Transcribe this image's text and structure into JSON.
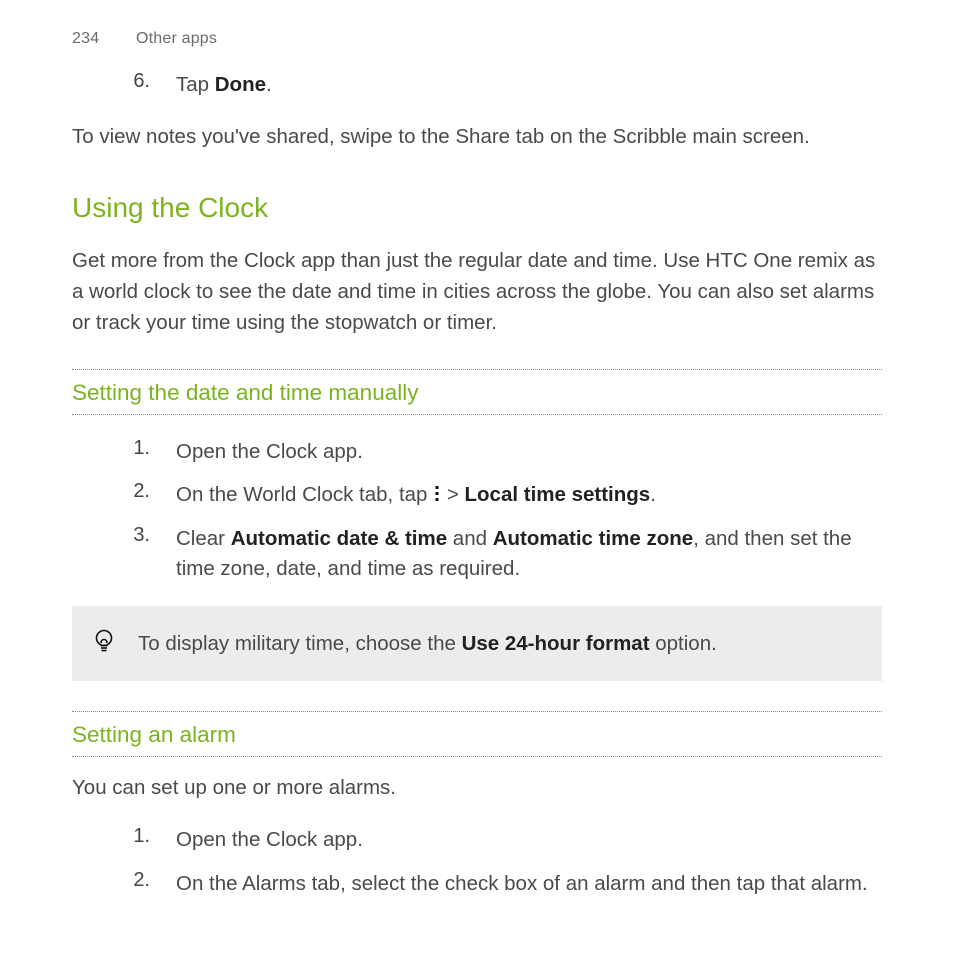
{
  "header": {
    "page_number": "234",
    "section": "Other apps"
  },
  "top_step": {
    "num": "6.",
    "prefix": "Tap ",
    "bold": "Done",
    "suffix": "."
  },
  "top_para": "To view notes you've shared, swipe to the Share tab on the Scribble main screen.",
  "section_heading": "Using the Clock",
  "section_intro": "Get more from the Clock app than just the regular date and time. Use HTC One remix as a world clock to see the date and time in cities across the globe. You can also set alarms or track your time using the stopwatch or timer.",
  "sub1": {
    "title": "Setting the date and time manually",
    "steps": {
      "s1": {
        "num": "1.",
        "text": "Open the Clock app."
      },
      "s2": {
        "num": "2.",
        "pre": "On the World Clock tab, tap ",
        "mid": " > ",
        "bold": "Local time settings",
        "post": "."
      },
      "s3": {
        "num": "3.",
        "pre": "Clear ",
        "b1": "Automatic date & time",
        "mid": " and ",
        "b2": "Automatic time zone",
        "post": ", and then set the time zone, date, and time as required."
      }
    },
    "tip": {
      "pre": "To display military time, choose the ",
      "bold": "Use 24-hour format",
      "post": " option."
    }
  },
  "sub2": {
    "title": "Setting an alarm",
    "intro": "You can set up one or more alarms.",
    "steps": {
      "s1": {
        "num": "1.",
        "text": "Open the Clock app."
      },
      "s2": {
        "num": "2.",
        "text": "On the Alarms tab, select the check box of an alarm and then tap that alarm."
      }
    }
  }
}
